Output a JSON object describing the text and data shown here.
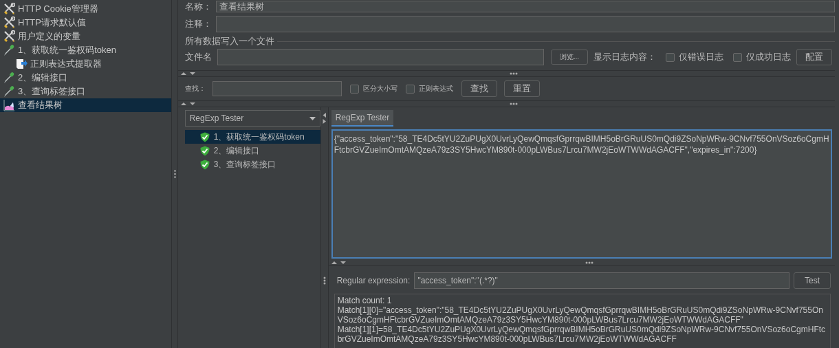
{
  "tree": [
    {
      "label": "HTTP Cookie管理器",
      "kind": "config",
      "selected": false
    },
    {
      "label": "HTTP请求默认值",
      "kind": "config",
      "selected": false
    },
    {
      "label": "用户定义的变量",
      "kind": "config",
      "selected": false
    },
    {
      "label": "1、获取统一鉴权码token",
      "kind": "sampler",
      "selected": false,
      "children": [
        {
          "label": "正则表达式提取器",
          "kind": "extractor",
          "selected": false
        }
      ]
    },
    {
      "label": "2、编辑接口",
      "kind": "sampler",
      "selected": false
    },
    {
      "label": "3、查询标签接口",
      "kind": "sampler",
      "selected": false
    },
    {
      "label": "查看结果树",
      "kind": "listener",
      "selected": true
    }
  ],
  "name_field": {
    "label": "名称：",
    "value": "查看结果树"
  },
  "comment_field": {
    "label": "注释："
  },
  "file_section": {
    "title": "所有数据写入一个文件",
    "file_label": "文件名",
    "browse_button": "浏览...",
    "log_label": "显示日志内容：",
    "checkboxes": [
      {
        "label": "仅错误日志",
        "checked": false
      },
      {
        "label": "仅成功日志",
        "checked": false
      }
    ],
    "config_button": "配置"
  },
  "search": {
    "label": "查找：",
    "options": [
      {
        "label": "区分大小写",
        "checked": false
      },
      {
        "label": "正则表达式",
        "checked": false
      }
    ],
    "buttons": [
      "查找",
      "重置"
    ]
  },
  "renderer_select": {
    "value": "RegExp Tester"
  },
  "results": [
    {
      "label": "1、获取统一鉴权码token",
      "passed": true,
      "selected": true
    },
    {
      "label": "2、编辑接口",
      "passed": true,
      "selected": false
    },
    {
      "label": "3、查询标签接口",
      "passed": true,
      "selected": false
    }
  ],
  "tabs": [
    {
      "label": "RegExp Tester",
      "selected": true
    }
  ],
  "response_text": "{\"access_token\":\"58_TE4Dc5tYU2ZuPUgX0UvrLyQewQmqsfGprrqwBIMH5oBrGRuUS0mQdi9ZSoNpWRw-9CNvf755OnVSoz6oCgmHFtcbrGVZueImOmtAMQzeA79z3SY5HwcYM890t-000pLWBus7Lrcu7MW2jEoWTWWdAGACFF\",\"expires_in\":7200}",
  "regex": {
    "label": "Regular expression:",
    "value": "\"access_token\":\"(.*?)\"",
    "button": "Test"
  },
  "match_output": [
    "Match count: 1",
    "Match[1][0]=\"access_token\":\"58_TE4Dc5tYU2ZuPUgX0UvrLyQewQmqsfGprrqwBIMH5oBrGRuUS0mQdi9ZSoNpWRw-9CNvf755OnVSoz6oCgmHFtcbrGVZueImOmtAMQzeA79z3SY5HwcYM890t-000pLWBus7Lrcu7MW2jEoWTWWdAGACFF\"",
    "Match[1][1]=58_TE4Dc5tYU2ZuPUgX0UvrLyQewQmqsfGprrqwBIMH5oBrGRuUS0mQdi9ZSoNpWRw-9CNvf755OnVSoz6oCgmHFtcbrGVZueImOmtAMQzeA79z3SY5HwcYM890t-000pLWBus7Lrcu7MW2jEoWTWWdAGACFF"
  ]
}
